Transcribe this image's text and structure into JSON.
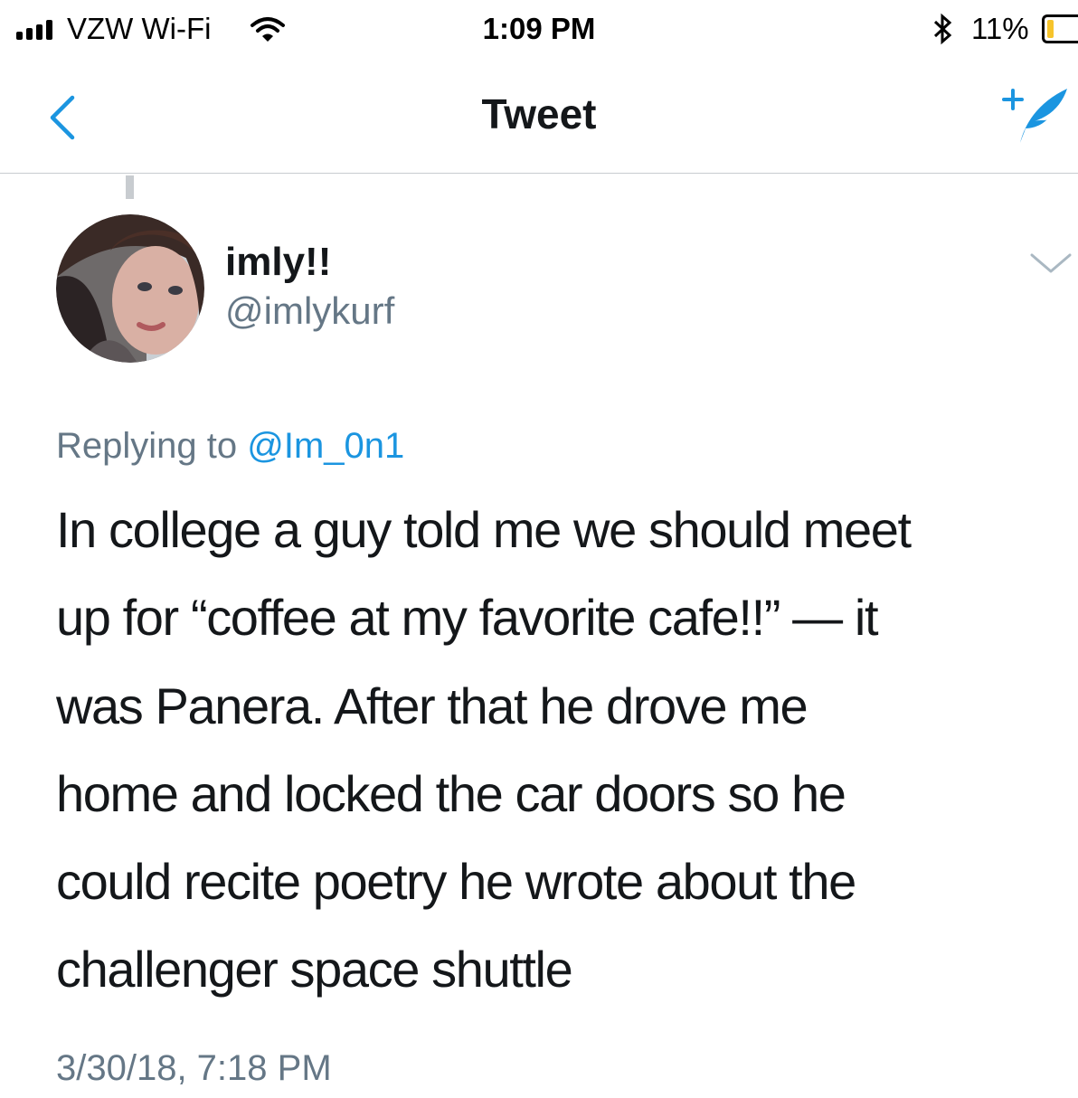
{
  "status_bar": {
    "carrier": "VZW Wi-Fi",
    "time": "1:09 PM",
    "battery_percent": "11%",
    "battery_level": 0.11,
    "icons": [
      "signal-icon",
      "wifi-icon",
      "bluetooth-icon",
      "battery-icon"
    ]
  },
  "nav": {
    "title": "Tweet",
    "icons": [
      "back-chevron-icon",
      "compose-tweet-icon"
    ],
    "accent_color": "#1b95e0"
  },
  "tweet": {
    "display_name": "imly!!",
    "handle": "@imlykurf",
    "replying_prefix": "Replying to",
    "reply_to": "@Im_0n1",
    "text_lines": [
      "In college a guy told me we should meet",
      "up for “coffee at my favorite cafe!!” — it",
      "was Panera. After that he drove me",
      "home and locked the car doors so he",
      "could recite poetry he wrote about the",
      "challenger space shuttle"
    ],
    "timestamp": "3/30/18, 7:18 PM",
    "icons": [
      "avatar-photo",
      "dropdown-caret-icon"
    ]
  }
}
